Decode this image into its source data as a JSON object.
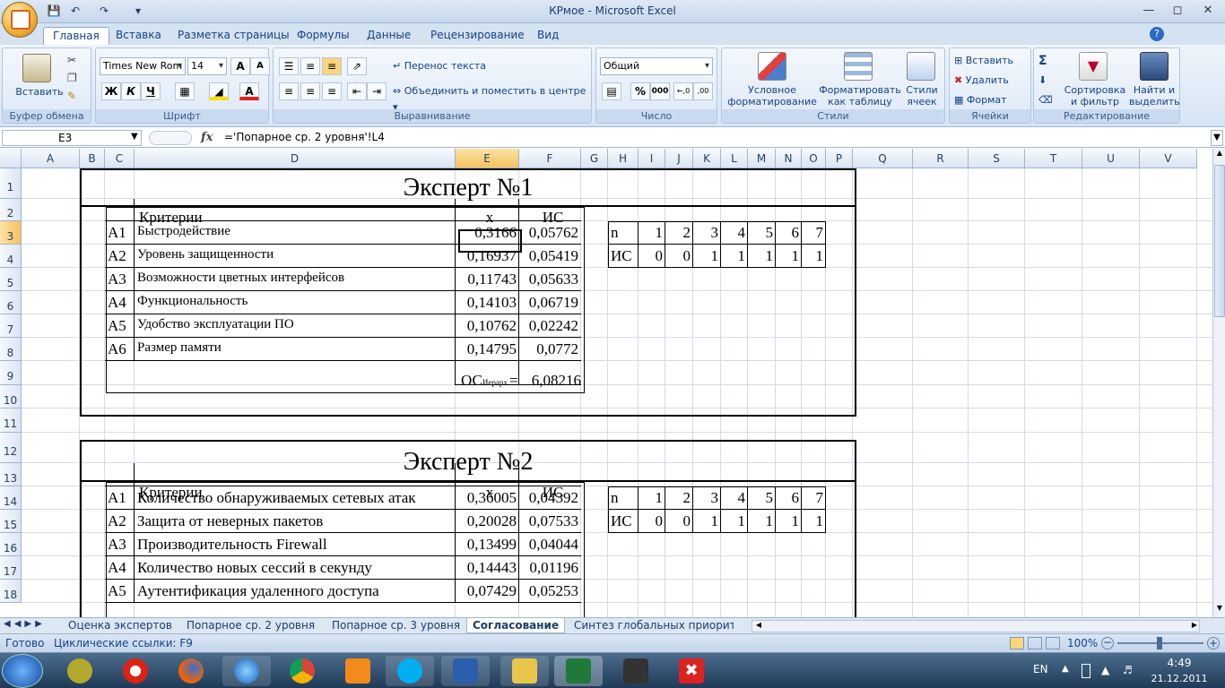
{
  "window": {
    "title": "КРмое - Microsoft Excel"
  },
  "tabs": [
    "Главная",
    "Вставка",
    "Разметка страницы",
    "Формулы",
    "Данные",
    "Рецензирование",
    "Вид"
  ],
  "ribbon": {
    "clipboard": {
      "label": "Буфер обмена",
      "paste": "Вставить"
    },
    "font": {
      "label": "Шрифт",
      "name": "Times New Rom",
      "size": "14",
      "bold": "Ж",
      "italic": "К",
      "underline": "Ч"
    },
    "alignment": {
      "label": "Выравнивание",
      "wrap": "Перенос текста",
      "merge": "Объединить и поместить в центре"
    },
    "number": {
      "label": "Число",
      "format": "Общий",
      "percent": "%",
      "thousands": "000"
    },
    "styles": {
      "label": "Стили",
      "conditional": "Условное форматирование",
      "table": "Форматировать как таблицу",
      "cell_styles": "Стили ячеек"
    },
    "cells": {
      "label": "Ячейки",
      "insert": "Вставить",
      "delete": "Удалить",
      "format": "Формат"
    },
    "editing": {
      "label": "Редактирование",
      "sort": "Сортировка и фильтр",
      "find": "Найти и выделить",
      "sigma": "Σ"
    }
  },
  "formula_bar": {
    "name_box": "E3",
    "fx": "fx",
    "formula": "='Попарное ср. 2 уровня'!L4"
  },
  "columns": [
    "A",
    "B",
    "C",
    "D",
    "E",
    "F",
    "G",
    "H",
    "I",
    "J",
    "K",
    "L",
    "M",
    "N",
    "O",
    "P",
    "Q",
    "R",
    "S",
    "T",
    "U",
    "V"
  ],
  "rows": [
    "1",
    "2",
    "3",
    "4",
    "5",
    "6",
    "7",
    "8",
    "9",
    "10",
    "11",
    "12",
    "13",
    "14",
    "15",
    "16",
    "17",
    "18"
  ],
  "expert1": {
    "title": "Эксперт №1",
    "header": {
      "crit": "Критерии",
      "x": "x",
      "is": "ИС"
    },
    "rows": [
      {
        "id": "A1",
        "name": "Быстродействие",
        "x": "0,3166",
        "is": "0,05762"
      },
      {
        "id": "A2",
        "name": "Уровень защищенности",
        "x": "0,16937",
        "is": "0,05419"
      },
      {
        "id": "A3",
        "name": "Возможности цветных интерфейсов",
        "x": "0,11743",
        "is": "0,05633"
      },
      {
        "id": "A4",
        "name": "Функциональность",
        "x": "0,14103",
        "is": "0,06719"
      },
      {
        "id": "A5",
        "name": "Удобство эксплуатации ПО",
        "x": "0,10762",
        "is": "0,02242"
      },
      {
        "id": "A6",
        "name": "Размер памяти",
        "x": "0,14795",
        "is": "0,0772"
      }
    ],
    "os_label": "ОС",
    "os_sub": "Иерарх.",
    "os_eq": "=",
    "os_value": "6,08216",
    "side": {
      "n_label": "n",
      "n": [
        "1",
        "2",
        "3",
        "4",
        "5",
        "6",
        "7"
      ],
      "is_label": "ИС",
      "is": [
        "0",
        "0",
        "1",
        "1",
        "1",
        "1",
        "1"
      ]
    }
  },
  "expert2": {
    "title": "Эксперт №2",
    "header": {
      "crit": "Критерии",
      "x": "x",
      "is": "ИС"
    },
    "rows": [
      {
        "id": "A1",
        "name": "Количество обнаруживаемых сетевых атак",
        "x": "0,36005",
        "is": "0,04392"
      },
      {
        "id": "A2",
        "name": "Защита от неверных пакетов",
        "x": "0,20028",
        "is": "0,07533"
      },
      {
        "id": "A3",
        "name": "Производительность Firewall",
        "x": "0,13499",
        "is": "0,04044"
      },
      {
        "id": "A4",
        "name": "Количество новых сессий в секунду",
        "x": "0,14443",
        "is": "0,01196"
      },
      {
        "id": "A5",
        "name": "Аутентификация удаленного доступа",
        "x": "0,07429",
        "is": "0,05253"
      }
    ],
    "side": {
      "n_label": "n",
      "n": [
        "1",
        "2",
        "3",
        "4",
        "5",
        "6",
        "7"
      ],
      "is_label": "ИС",
      "is": [
        "0",
        "0",
        "1",
        "1",
        "1",
        "1",
        "1"
      ]
    }
  },
  "sheet_tabs": [
    "Оценка экспертов",
    "Попарное ср. 2 уровня",
    "Попарное ср. 3 уровня",
    "Согласование",
    "Синтез глобальных приорите"
  ],
  "active_sheet": "Согласование",
  "status": {
    "ready": "Готово",
    "circular": "Циклические ссылки: F9",
    "zoom": "100%"
  },
  "taskbar": {
    "lang": "EN",
    "time": "4:49",
    "date": "21.12.2011"
  }
}
